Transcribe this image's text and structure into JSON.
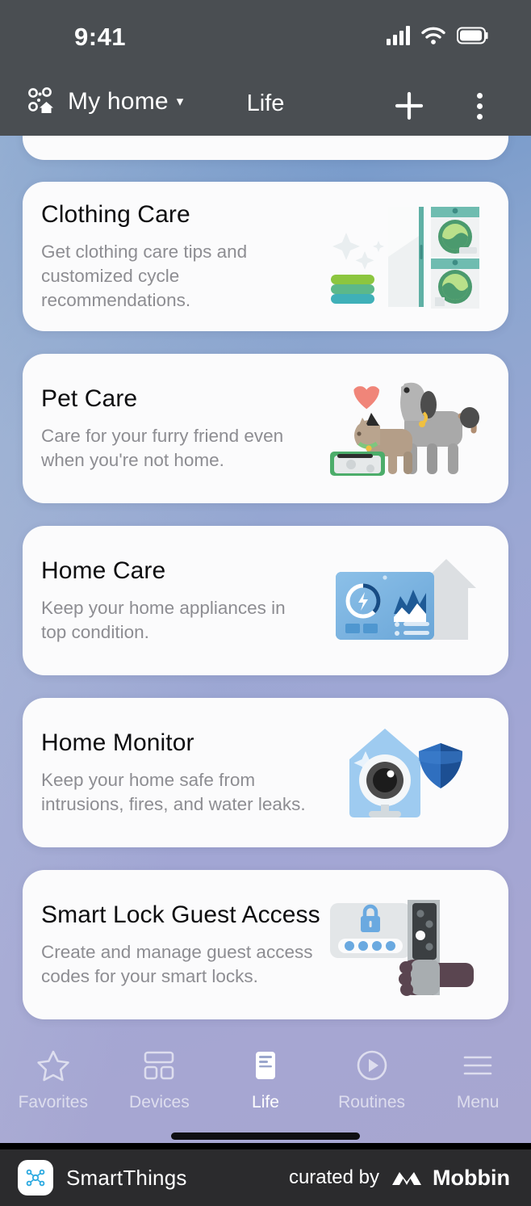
{
  "statusbar": {
    "time": "9:41",
    "signal_icon": "cellular-signal-icon",
    "wifi_icon": "wifi-icon",
    "battery_icon": "battery-icon"
  },
  "header": {
    "home_icon": "smartthings-home-icon",
    "home_name": "My home",
    "caret": "▾",
    "title": "Life",
    "add_label": "+",
    "more_icon": "more-options-icon"
  },
  "cards": [
    {
      "title": "Clothing Care",
      "subtitle": "Get clothing care tips and customized cycle recommendations.",
      "art": "washer-dryer-laundry-illustration"
    },
    {
      "title": "Pet Care",
      "subtitle": "Care for your furry friend even when you're not home.",
      "art": "dog-cat-feeder-illustration"
    },
    {
      "title": "Home Care",
      "subtitle": "Keep your home appliances in top condition.",
      "art": "appliance-dashboard-house-illustration"
    },
    {
      "title": "Home Monitor",
      "subtitle": "Keep your home safe from intrusions, fires, and water leaks.",
      "art": "camera-house-shield-illustration"
    },
    {
      "title": "Smart Lock Guest Access",
      "subtitle": "Create and manage guest access codes for your smart locks.",
      "art": "keypad-lock-hand-illustration"
    }
  ],
  "tabbar": {
    "items": [
      {
        "label": "Favorites",
        "icon": "star-icon",
        "active": false
      },
      {
        "label": "Devices",
        "icon": "grid-icon",
        "active": false
      },
      {
        "label": "Life",
        "icon": "life-card-icon",
        "active": true
      },
      {
        "label": "Routines",
        "icon": "play-circle-icon",
        "active": false
      },
      {
        "label": "Menu",
        "icon": "hamburger-menu-icon",
        "active": false
      }
    ]
  },
  "footer": {
    "app_icon": "smartthings-logo-icon",
    "app_name": "SmartThings",
    "curated_by": "curated by",
    "brand_icon": "mobbin-logo-icon",
    "brand": "Mobbin"
  },
  "colors": {
    "header_bg": "#4a4e52",
    "card_bg": "#fbfbfc",
    "title": "#0d0d0f",
    "subtitle": "#8d8d92",
    "footer_bg": "#2b2b2d",
    "accent_blue": "#5d8fc6",
    "accent_lavender": "#a7a6d0"
  }
}
